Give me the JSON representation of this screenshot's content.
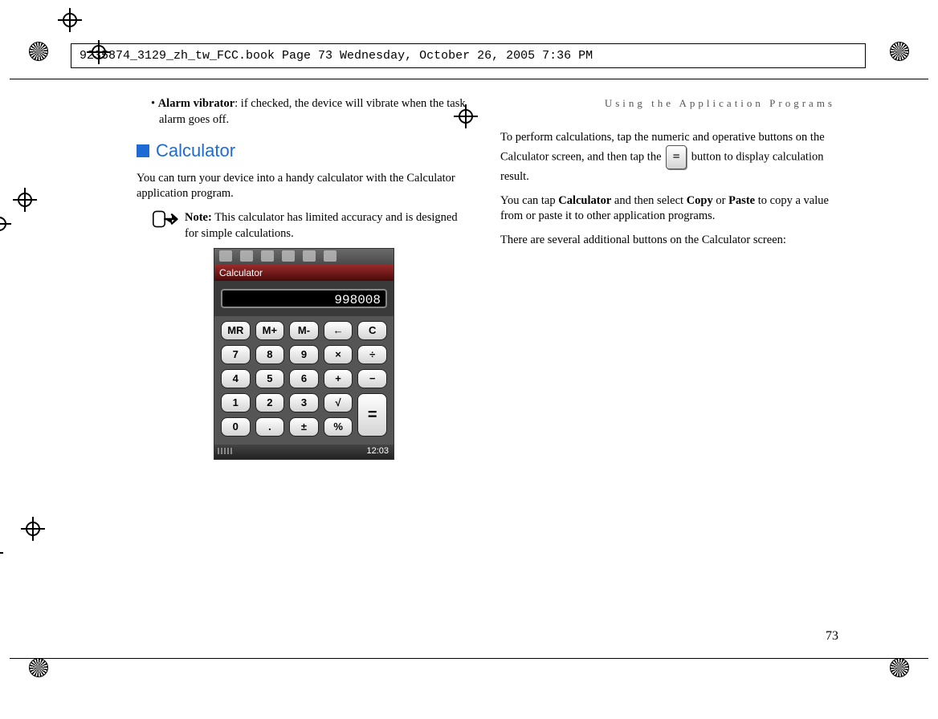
{
  "header": {
    "slug": "9235874_3129_zh_tw_FCC.book  Page 73  Wednesday, October 26, 2005  7:36 PM"
  },
  "running_head": "Using the Application Programs",
  "left_col": {
    "alarm_label": "Alarm vibrator",
    "alarm_text": ": if checked, the device will vibrate when the task alarm goes off.",
    "section_title": "Calculator",
    "section_intro": "You can turn your device into a handy calculator with the Calculator application program.",
    "note_label": "Note:",
    "note_text": " This calculator has limited accuracy and is designed for simple calculations."
  },
  "calculator": {
    "title": "Calculator",
    "display": "998008",
    "row1": [
      "MR",
      "M+",
      "M-",
      "←",
      "C"
    ],
    "row2": [
      "7",
      "8",
      "9",
      "×",
      "÷"
    ],
    "row3": [
      "4",
      "5",
      "6",
      "+",
      "−"
    ],
    "row4": [
      "1",
      "2",
      "3",
      "√"
    ],
    "row5": [
      "0",
      ".",
      "±",
      "%"
    ],
    "equals": "=",
    "status_time": "12:03"
  },
  "right_col": {
    "p1a": "To perform calculations, tap the numeric and operative buttons on the Calculator screen, and then tap the ",
    "p1b": " button to display calculation result.",
    "p2a": "You can tap ",
    "p2_calc": "Calculator",
    "p2b": " and then select ",
    "p2_copy": "Copy",
    "p2c": " or ",
    "p2_paste": "Paste",
    "p2d": " to copy a value from or paste it to other application programs.",
    "p3": "There are several additional buttons on the Calculator screen:",
    "eq": "="
  },
  "page_number": "73"
}
